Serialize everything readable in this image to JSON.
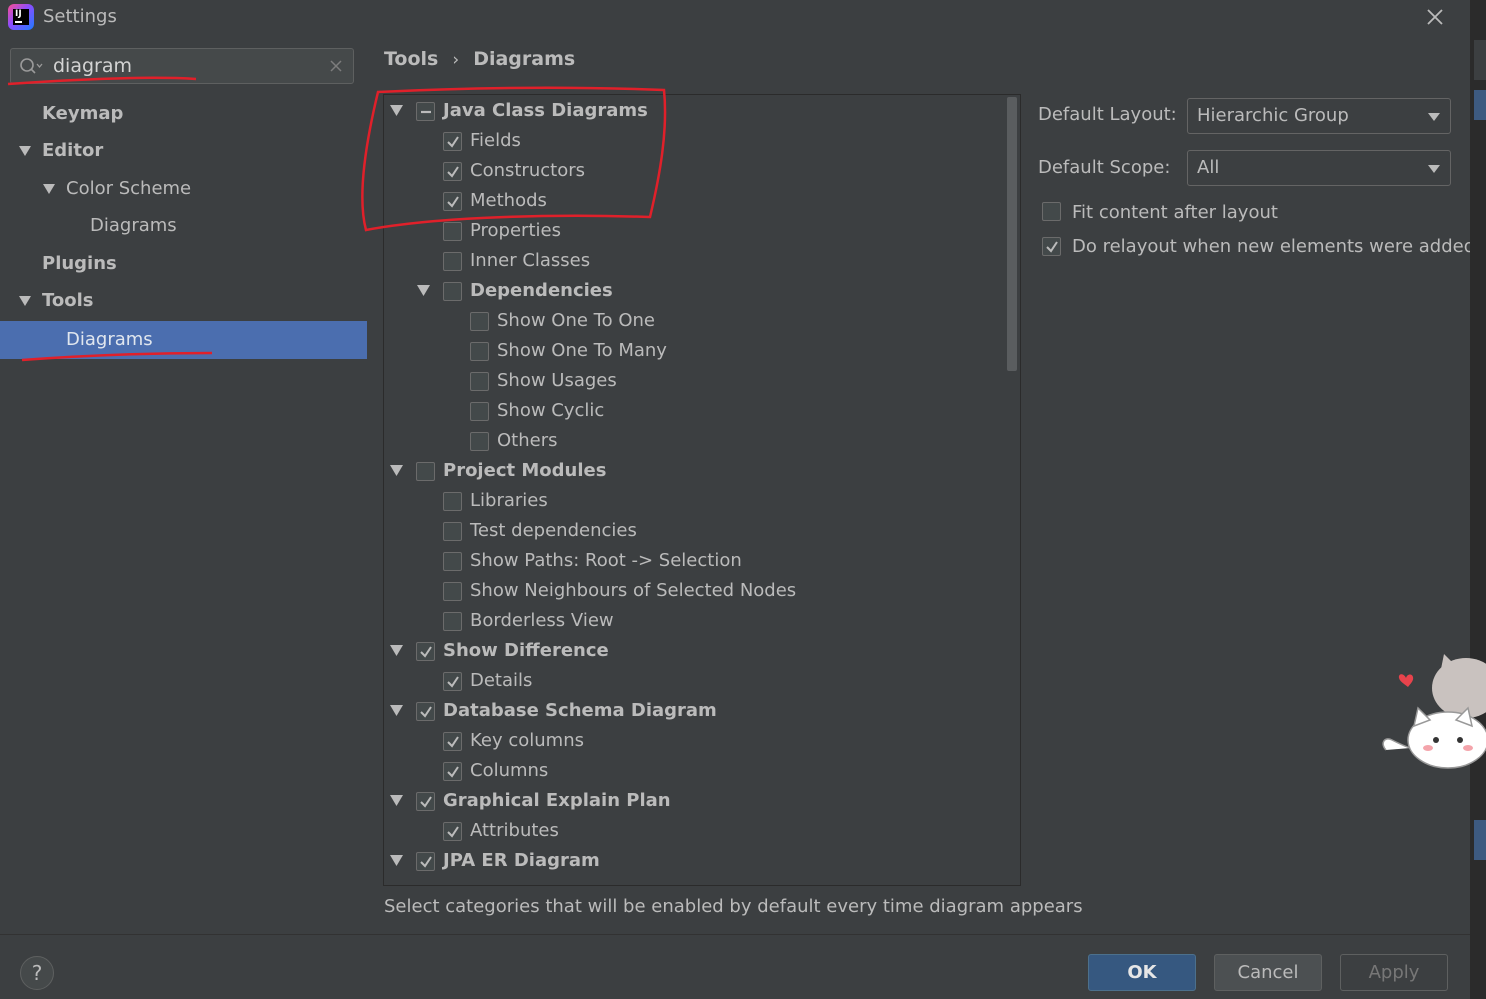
{
  "window": {
    "title": "Settings"
  },
  "search": {
    "value": "diagram"
  },
  "sidebar": {
    "items": [
      {
        "label": "Keymap"
      },
      {
        "label": "Editor"
      },
      {
        "label": "Color Scheme"
      },
      {
        "label": "Diagrams"
      },
      {
        "label": "Plugins"
      },
      {
        "label": "Tools"
      },
      {
        "label": "Diagrams"
      }
    ]
  },
  "breadcrumb": {
    "parent": "Tools",
    "separator": "›",
    "current": "Diagrams"
  },
  "tree": [
    {
      "label": "Java Class Diagrams",
      "state": "partial",
      "expanded": true
    },
    {
      "label": "Fields",
      "state": "checked"
    },
    {
      "label": "Constructors",
      "state": "checked"
    },
    {
      "label": "Methods",
      "state": "checked"
    },
    {
      "label": "Properties",
      "state": "unchecked"
    },
    {
      "label": "Inner Classes",
      "state": "unchecked"
    },
    {
      "label": "Dependencies",
      "state": "unchecked",
      "expanded": true
    },
    {
      "label": "Show One To One",
      "state": "unchecked"
    },
    {
      "label": "Show One To Many",
      "state": "unchecked"
    },
    {
      "label": "Show Usages",
      "state": "unchecked"
    },
    {
      "label": "Show Cyclic",
      "state": "unchecked"
    },
    {
      "label": "Others",
      "state": "unchecked"
    },
    {
      "label": "Project Modules",
      "state": "unchecked",
      "expanded": true
    },
    {
      "label": "Libraries",
      "state": "unchecked"
    },
    {
      "label": "Test dependencies",
      "state": "unchecked"
    },
    {
      "label": "Show Paths: Root -> Selection",
      "state": "unchecked"
    },
    {
      "label": "Show Neighbours of Selected Nodes",
      "state": "unchecked"
    },
    {
      "label": "Borderless View",
      "state": "unchecked"
    },
    {
      "label": "Show Difference",
      "state": "checked",
      "expanded": true
    },
    {
      "label": "Details",
      "state": "checked"
    },
    {
      "label": "Database Schema Diagram",
      "state": "checked",
      "expanded": true
    },
    {
      "label": "Key columns",
      "state": "checked"
    },
    {
      "label": "Columns",
      "state": "checked"
    },
    {
      "label": "Graphical Explain Plan",
      "state": "checked",
      "expanded": true
    },
    {
      "label": "Attributes",
      "state": "checked"
    },
    {
      "label": "JPA ER Diagram",
      "state": "checked",
      "expanded": true
    }
  ],
  "hint": "Select categories that will be enabled by default every time diagram appears",
  "options": {
    "default_layout_label": "Default Layout:",
    "default_layout_value": "Hierarchic Group",
    "default_scope_label": "Default Scope:",
    "default_scope_value": "All",
    "fit_content_label": "Fit content after layout",
    "fit_content_checked": false,
    "relayout_label": "Do relayout when new elements were added",
    "relayout_checked": true
  },
  "buttons": {
    "help": "?",
    "ok": "OK",
    "cancel": "Cancel",
    "apply": "Apply"
  },
  "colors": {
    "accent": "#4b6eaf",
    "background": "#3c3f41",
    "annotation": "#e0202a"
  }
}
